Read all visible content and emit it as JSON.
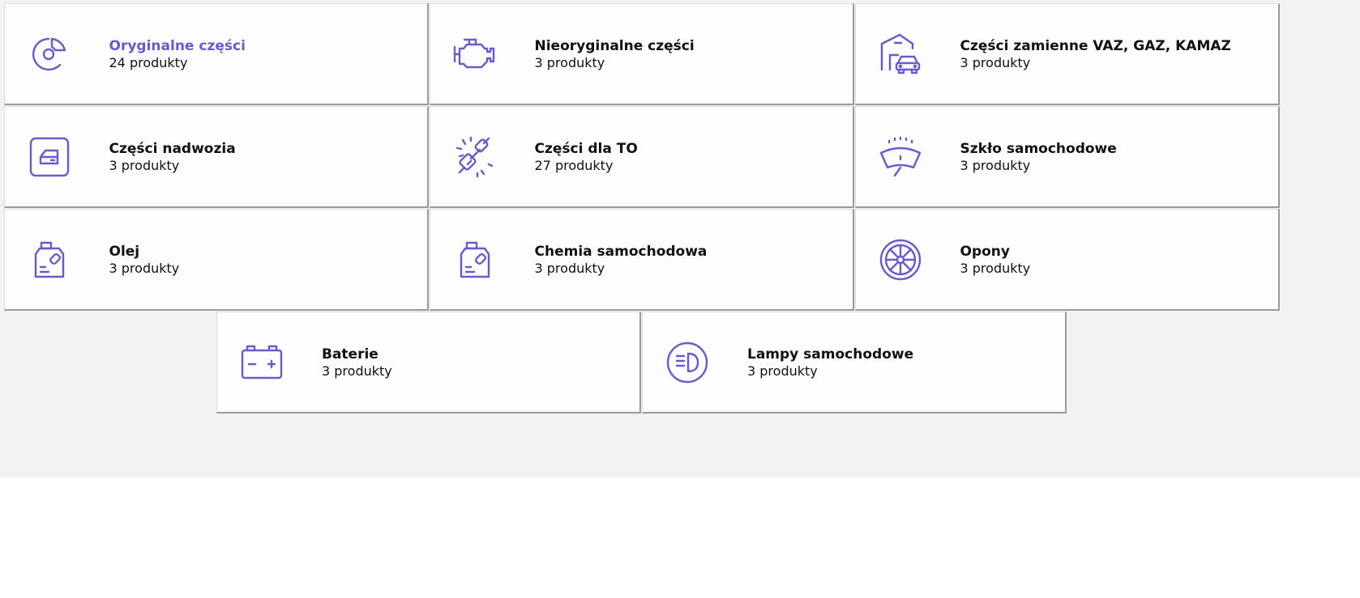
{
  "accent_color": "#6a5acd",
  "categories": [
    {
      "title": "Oryginalne części",
      "count": "24 produkty",
      "icon": "brake-disc-icon"
    },
    {
      "title": "Nieoryginalne części",
      "count": "3 produkty",
      "icon": "engine-icon"
    },
    {
      "title": "Części zamienne VAZ, GAZ, KAMAZ",
      "count": "3 produkty",
      "icon": "garage-car-icon"
    },
    {
      "title": "Części nadwozia",
      "count": "3 produkty",
      "icon": "car-door-icon"
    },
    {
      "title": "Części dla TO",
      "count": "27 produkty",
      "icon": "spark-plug-icon"
    },
    {
      "title": "Szkło samochodowe",
      "count": "3 produkty",
      "icon": "windshield-wiper-icon"
    },
    {
      "title": "Olej",
      "count": "3 produkty",
      "icon": "oil-canister-icon"
    },
    {
      "title": "Chemia samochodowa",
      "count": "3 produkty",
      "icon": "chemical-canister-icon"
    },
    {
      "title": "Opony",
      "count": "3 produkty",
      "icon": "tire-wheel-icon"
    },
    {
      "title": "Baterie",
      "count": "3 produkty",
      "icon": "battery-icon"
    },
    {
      "title": "Lampy samochodowe",
      "count": "3 produkty",
      "icon": "headlight-icon"
    }
  ]
}
